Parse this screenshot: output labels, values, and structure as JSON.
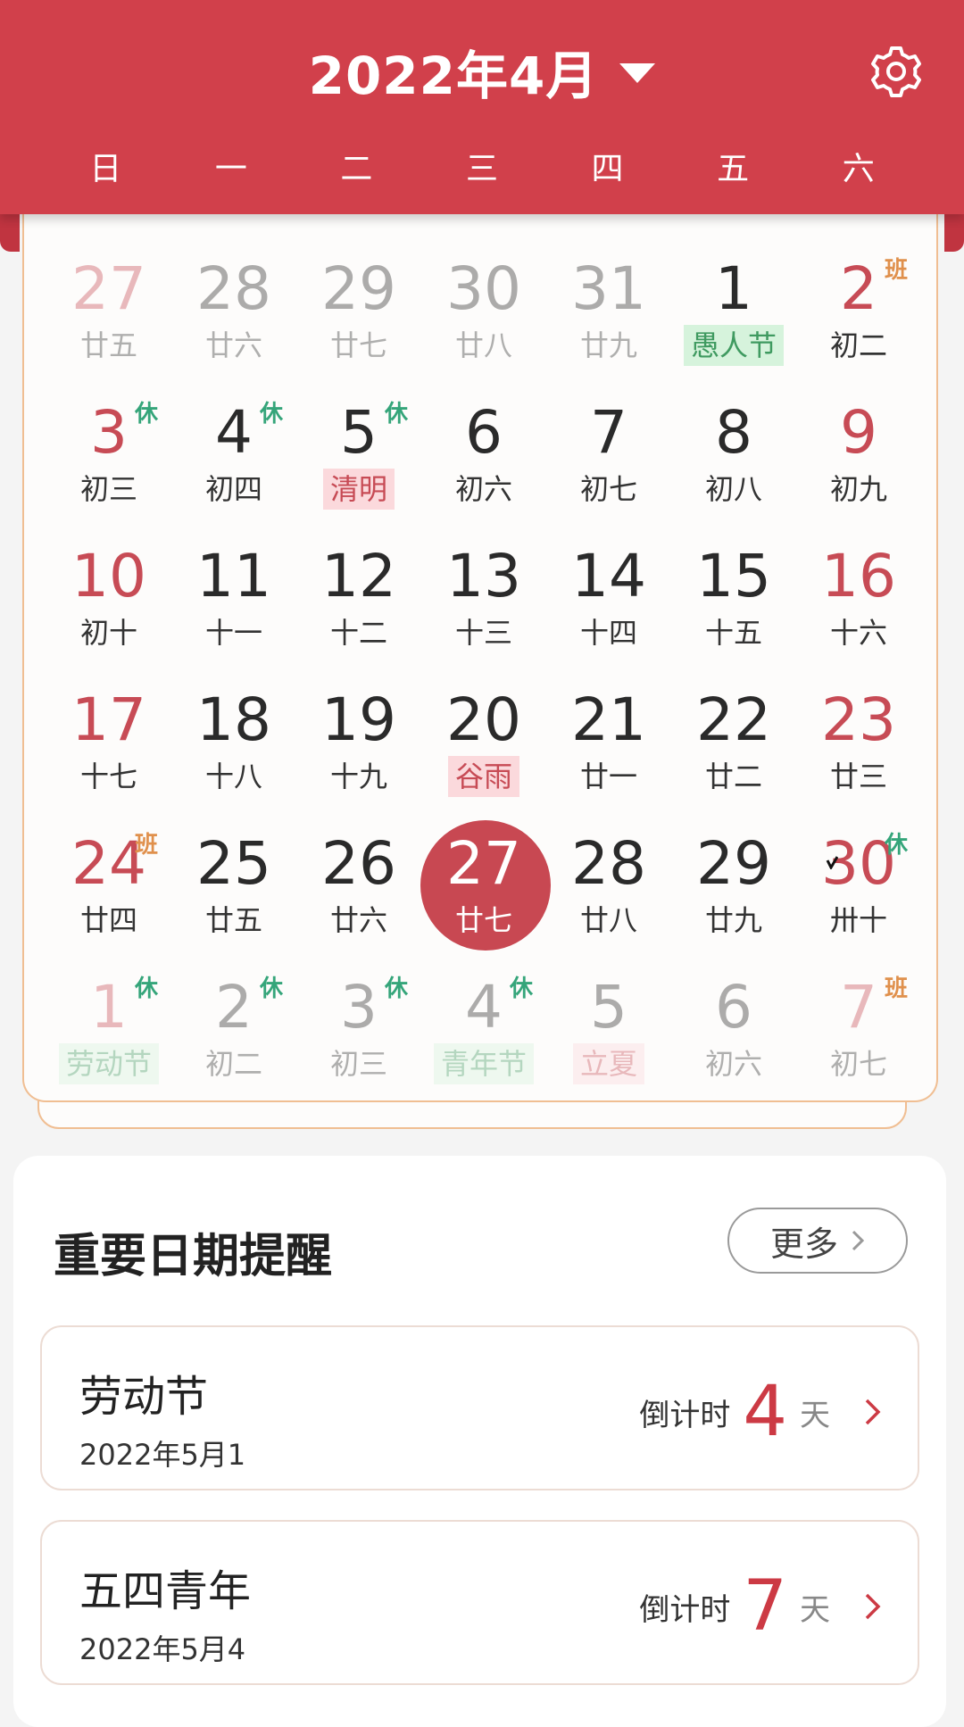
{
  "header": {
    "title": "2022年4月",
    "weekdays": [
      "日",
      "一",
      "二",
      "三",
      "四",
      "五",
      "六"
    ]
  },
  "calendar": {
    "days": [
      {
        "n": "27",
        "l": "廿五",
        "other": true,
        "weekend": true
      },
      {
        "n": "28",
        "l": "廿六",
        "other": true
      },
      {
        "n": "29",
        "l": "廿七",
        "other": true
      },
      {
        "n": "30",
        "l": "廿八",
        "other": true
      },
      {
        "n": "31",
        "l": "廿九",
        "other": true
      },
      {
        "n": "1",
        "l": "愚人节",
        "hl": "green"
      },
      {
        "n": "2",
        "l": "初二",
        "weekend": true,
        "badge": "班",
        "badgeType": "work"
      },
      {
        "n": "3",
        "l": "初三",
        "weekend": true,
        "badge": "休",
        "badgeType": "rest"
      },
      {
        "n": "4",
        "l": "初四",
        "badge": "休",
        "badgeType": "rest"
      },
      {
        "n": "5",
        "l": "清明",
        "hl": "pink",
        "badge": "休",
        "badgeType": "rest"
      },
      {
        "n": "6",
        "l": "初六"
      },
      {
        "n": "7",
        "l": "初七"
      },
      {
        "n": "8",
        "l": "初八"
      },
      {
        "n": "9",
        "l": "初九",
        "weekend": true
      },
      {
        "n": "10",
        "l": "初十",
        "weekend": true
      },
      {
        "n": "11",
        "l": "十一"
      },
      {
        "n": "12",
        "l": "十二"
      },
      {
        "n": "13",
        "l": "十三"
      },
      {
        "n": "14",
        "l": "十四"
      },
      {
        "n": "15",
        "l": "十五"
      },
      {
        "n": "16",
        "l": "十六",
        "weekend": true
      },
      {
        "n": "17",
        "l": "十七",
        "weekend": true
      },
      {
        "n": "18",
        "l": "十八"
      },
      {
        "n": "19",
        "l": "十九"
      },
      {
        "n": "20",
        "l": "谷雨",
        "hl": "pink"
      },
      {
        "n": "21",
        "l": "廿一"
      },
      {
        "n": "22",
        "l": "廿二"
      },
      {
        "n": "23",
        "l": "廿三",
        "weekend": true
      },
      {
        "n": "24",
        "l": "廿四",
        "weekend": true,
        "badge": "班",
        "badgeType": "work"
      },
      {
        "n": "25",
        "l": "廿五"
      },
      {
        "n": "26",
        "l": "廿六"
      },
      {
        "n": "27",
        "l": "廿七",
        "today": true
      },
      {
        "n": "28",
        "l": "廿八"
      },
      {
        "n": "29",
        "l": "廿九"
      },
      {
        "n": "30",
        "l": "卅十",
        "weekend": true,
        "badge": "休",
        "badgeType": "rest"
      },
      {
        "n": "1",
        "l": "劳动节",
        "other": true,
        "weekend": true,
        "hl": "green",
        "badge": "休",
        "badgeType": "rest"
      },
      {
        "n": "2",
        "l": "初二",
        "other": true,
        "badge": "休",
        "badgeType": "rest"
      },
      {
        "n": "3",
        "l": "初三",
        "other": true,
        "badge": "休",
        "badgeType": "rest"
      },
      {
        "n": "4",
        "l": "青年节",
        "other": true,
        "hl": "green",
        "badge": "休",
        "badgeType": "rest"
      },
      {
        "n": "5",
        "l": "立夏",
        "other": true,
        "hl": "pink"
      },
      {
        "n": "6",
        "l": "初六",
        "other": true
      },
      {
        "n": "7",
        "l": "初七",
        "other": true,
        "weekend": true,
        "badge": "班",
        "badgeType": "work"
      }
    ]
  },
  "reminders": {
    "title": "重要日期提醒",
    "more_label": "更多",
    "events": [
      {
        "name": "劳动节",
        "date": "2022年5月1",
        "countdown_label": "倒计时",
        "days": "4",
        "unit": "天"
      },
      {
        "name": "五四青年",
        "date": "2022年5月4",
        "countdown_label": "倒计时",
        "days": "7",
        "unit": "天"
      }
    ]
  },
  "colors": {
    "header_red": "#d1404b",
    "rest_green": "#35a57a",
    "work_orange": "#e0904c",
    "today_circle": "#c84852"
  }
}
